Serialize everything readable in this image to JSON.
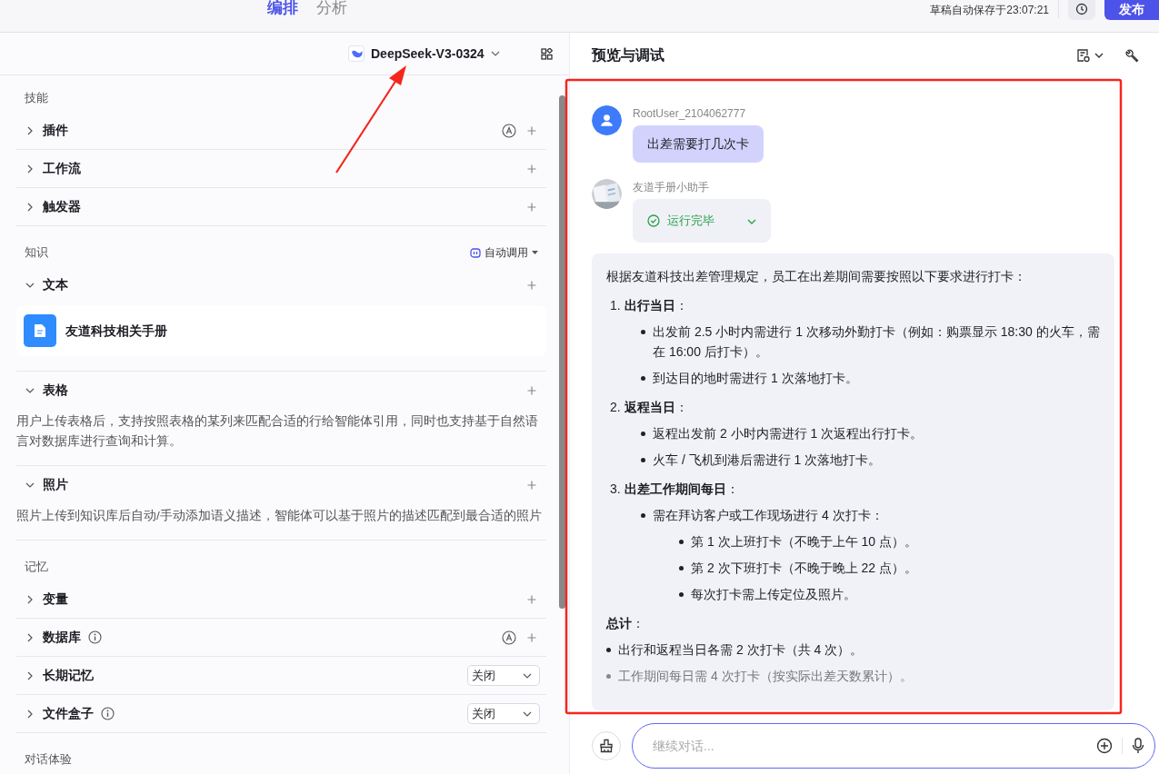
{
  "header": {
    "tabs": [
      {
        "label": "编排",
        "selected": true
      },
      {
        "label": "分析",
        "selected": false
      }
    ],
    "autosave": "草稿自动保存于23:07:21",
    "publish_button": "发布"
  },
  "model_bar": {
    "model": "DeepSeek-V3-0324"
  },
  "sections": [
    {
      "title": "技能",
      "items": [
        {
          "label": "插件",
          "kind": "add",
          "expanded": false,
          "auto": true
        },
        {
          "label": "工作流",
          "kind": "add",
          "expanded": false
        },
        {
          "label": "触发器",
          "kind": "add",
          "expanded": false
        }
      ]
    },
    {
      "title": "知识",
      "mode": "自动调用",
      "items": [
        {
          "label": "文本",
          "kind": "add",
          "expanded": true,
          "documents": [
            {
              "name": "友道科技相关手册"
            }
          ]
        },
        {
          "label": "表格",
          "kind": "add",
          "expanded": true,
          "description": "用户上传表格后，支持按照表格的某列来匹配合适的行给智能体引用，同时也支持基于自然语言对数据库进行查询和计算。"
        },
        {
          "label": "照片",
          "kind": "add",
          "expanded": true,
          "description": "照片上传到知识库后自动/手动添加语义描述，智能体可以基于照片的描述匹配到最合适的照片"
        }
      ]
    },
    {
      "title": "记忆",
      "items": [
        {
          "label": "变量",
          "kind": "add",
          "expanded": false
        },
        {
          "label": "数据库",
          "kind": "add",
          "expanded": false,
          "info": true,
          "auto": true
        },
        {
          "label": "长期记忆",
          "kind": "select",
          "expanded": false,
          "value": "关闭"
        },
        {
          "label": "文件盒子",
          "kind": "select",
          "expanded": false,
          "info": true,
          "value": "关闭"
        }
      ]
    },
    {
      "title": "对话体验"
    }
  ],
  "chat": {
    "title": "预览与调试",
    "messages": [
      {
        "kind": "user",
        "name": "RootUser_2104062777",
        "text": "出差需要打几次卡"
      },
      {
        "kind": "bot",
        "name": "友道手册小助手",
        "status": "运行完毕",
        "answer": {
          "intro": "根据友道科技出差管理规定，员工在出差期间需要按照以下要求进行打卡：",
          "steps": [
            {
              "number": "1.",
              "title": "**出行当日**：",
              "bullets": [
                {
                  "text": "出发前 2.5 小时内需进行 1 次移动外勤打卡（例如：购票显示 18:30 的火车，需在 16:00 后打卡）。"
                },
                {
                  "text": "到达目的地时需进行 1 次落地打卡。"
                }
              ]
            },
            {
              "number": "2.",
              "title": "**返程当日**：",
              "bullets": [
                {
                  "text": "返程出发前 2 小时内需进行 1 次返程出行打卡。"
                },
                {
                  "text": "火车 / 飞机到港后需进行 1 次落地打卡。"
                }
              ]
            },
            {
              "number": "3.",
              "title": "**出差工作期间每日**：",
              "bullets": [
                {
                  "text": "需在拜访客户或工作现场进行 4 次打卡：",
                  "children": [
                    {
                      "text": "第 1 次上班打卡（不晚于上午 10 点）。"
                    },
                    {
                      "text": "第 2 次下班打卡（不晚于晚上 22 点）。"
                    },
                    {
                      "text": "每次打卡需上传定位及照片。"
                    }
                  ]
                }
              ]
            }
          ],
          "summary_title": "**总计**：",
          "summary": [
            "出行和返程当日各需 2 次打卡（共 4 次）。",
            "工作期间每日需 4 次打卡（按实际出差天数累计）。"
          ]
        }
      }
    ],
    "input": {
      "placeholder": "继续对话..."
    }
  },
  "annotations": {
    "arrow": true,
    "highlight_frame": true
  }
}
